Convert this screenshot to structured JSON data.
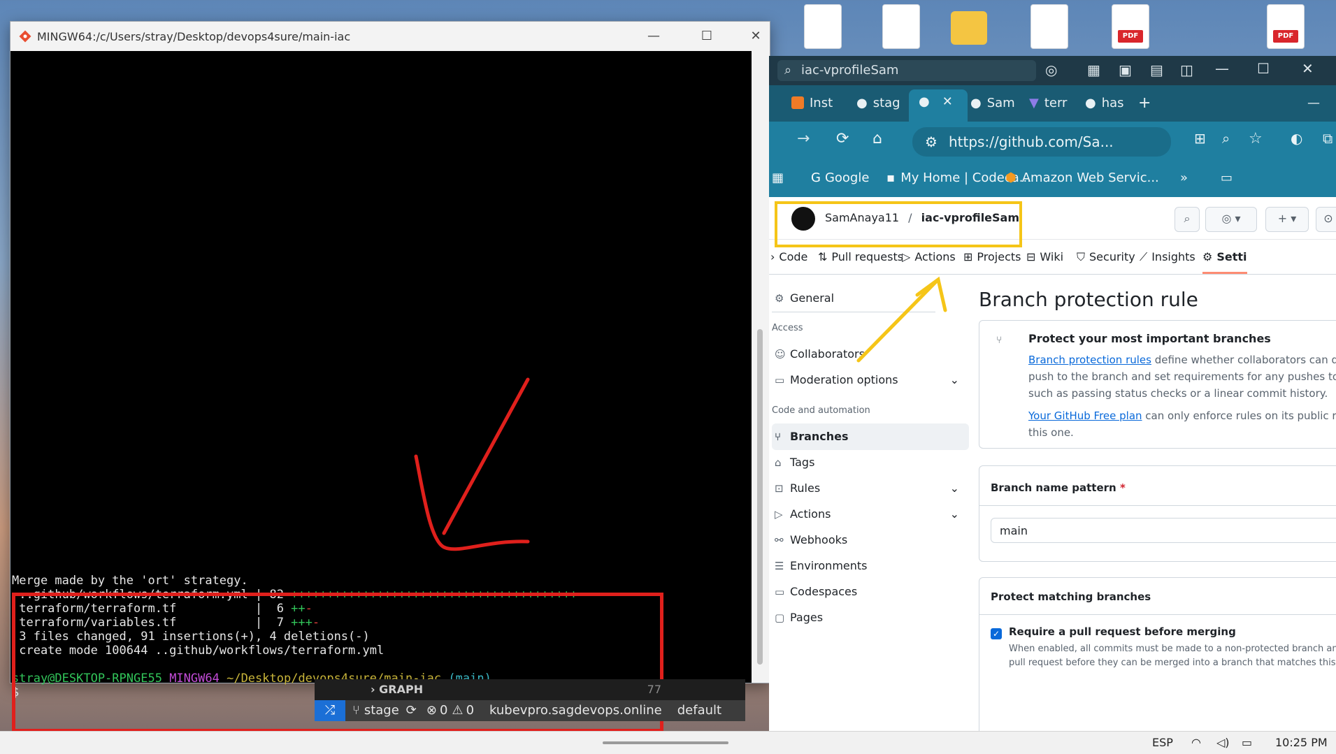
{
  "desktop": {
    "icons": [
      {
        "label": "",
        "type": "file"
      },
      {
        "label": "",
        "type": "file"
      },
      {
        "label": "",
        "type": "folder"
      },
      {
        "label": "",
        "type": "media"
      },
      {
        "label": "PDF",
        "type": "pdf"
      },
      {
        "label": "PDF",
        "type": "pdf"
      }
    ]
  },
  "terminal": {
    "title": "MINGW64:/c/Users/stray/Desktop/devops4sure/main-iac",
    "lines": [
      "Merge made by the 'ort' strategy.",
      " ..github/workflows/terraform.yml | 82 ",
      " terraform/terraform.tf           |  6 ",
      " terraform/variables.tf           |  7 ",
      " 3 files changed, 91 insertions(+), 4 deletions(-)",
      " create mode 100644 ..github/workflows/terraform.yml"
    ],
    "diff_marks": [
      {
        "plus": "++++++++++++++++++++++++++++++++++++++++",
        "minus": ""
      },
      {
        "plus": "++",
        "minus": "-"
      },
      {
        "plus": "+++",
        "minus": "-"
      }
    ],
    "prompt": {
      "user_host": "stray@DESKTOP-RPNGE55",
      "shell": "MINGW64",
      "path": "~/Desktop/devops4sure/main-iac",
      "branch": "(main)",
      "symbol": "$"
    }
  },
  "vscode": {
    "graph_label": "GRAPH",
    "graph_num": "77",
    "branch": "stage",
    "errors": "0",
    "warnings": "0",
    "host": "kubevpro.sagdevops.online",
    "profile": "default"
  },
  "browser": {
    "search_text": "iac-vprofileSam",
    "tabs": [
      {
        "label": "Inst"
      },
      {
        "label": "stag"
      },
      {
        "label": ""
      },
      {
        "label": "Sam"
      },
      {
        "label": "terr"
      },
      {
        "label": "has"
      }
    ],
    "url": "https://github.com/Sa...",
    "bookmarks": [
      {
        "label": "Google"
      },
      {
        "label": "My Home | Codeca..."
      },
      {
        "label": "Amazon Web Servic..."
      }
    ]
  },
  "github": {
    "owner": "SamAnaya11",
    "repo": "iac-vprofileSam",
    "nav": [
      "Code",
      "Pull requests",
      "Actions",
      "Projects",
      "Wiki",
      "Security",
      "Insights",
      "Setti"
    ],
    "sidebar": {
      "general": "General",
      "access_head": "Access",
      "collaborators": "Collaborators",
      "moderation": "Moderation options",
      "code_head": "Code and automation",
      "branches": "Branches",
      "tags": "Tags",
      "rules": "Rules",
      "actions": "Actions",
      "webhooks": "Webhooks",
      "environments": "Environments",
      "codespaces": "Codespaces",
      "pages": "Pages"
    },
    "main": {
      "title": "Branch protection rule",
      "protect_title": "Protect your most important branches",
      "bpr_link": "Branch protection rules",
      "bpr_text": " define whether collaborators can delete",
      "bpr_text2": "push to the branch and set requirements for any pushes to the b",
      "bpr_text3": "such as passing status checks or a linear commit history.",
      "plan_link": "Your GitHub Free plan",
      "plan_text": " can only enforce rules on its public repos",
      "plan_text2": "this one.",
      "pattern_label": "Branch name pattern",
      "pattern_required": "*",
      "pattern_value": "main",
      "protect_matching": "Protect matching branches",
      "require_pr": "Require a pull request before merging",
      "require_pr_desc1": "When enabled, all commits must be made to a non-protected branch and subm",
      "require_pr_desc2": "pull request before they can be merged into a branch that matches this rule."
    }
  },
  "taskbar": {
    "lang": "ESP",
    "time": "10:25 PM"
  },
  "colors": {
    "annotation_red": "#e0201c",
    "annotation_yellow": "#f5c518",
    "browser_tab_bar": "#1a5b73",
    "browser_addr": "#1f7fa0"
  }
}
